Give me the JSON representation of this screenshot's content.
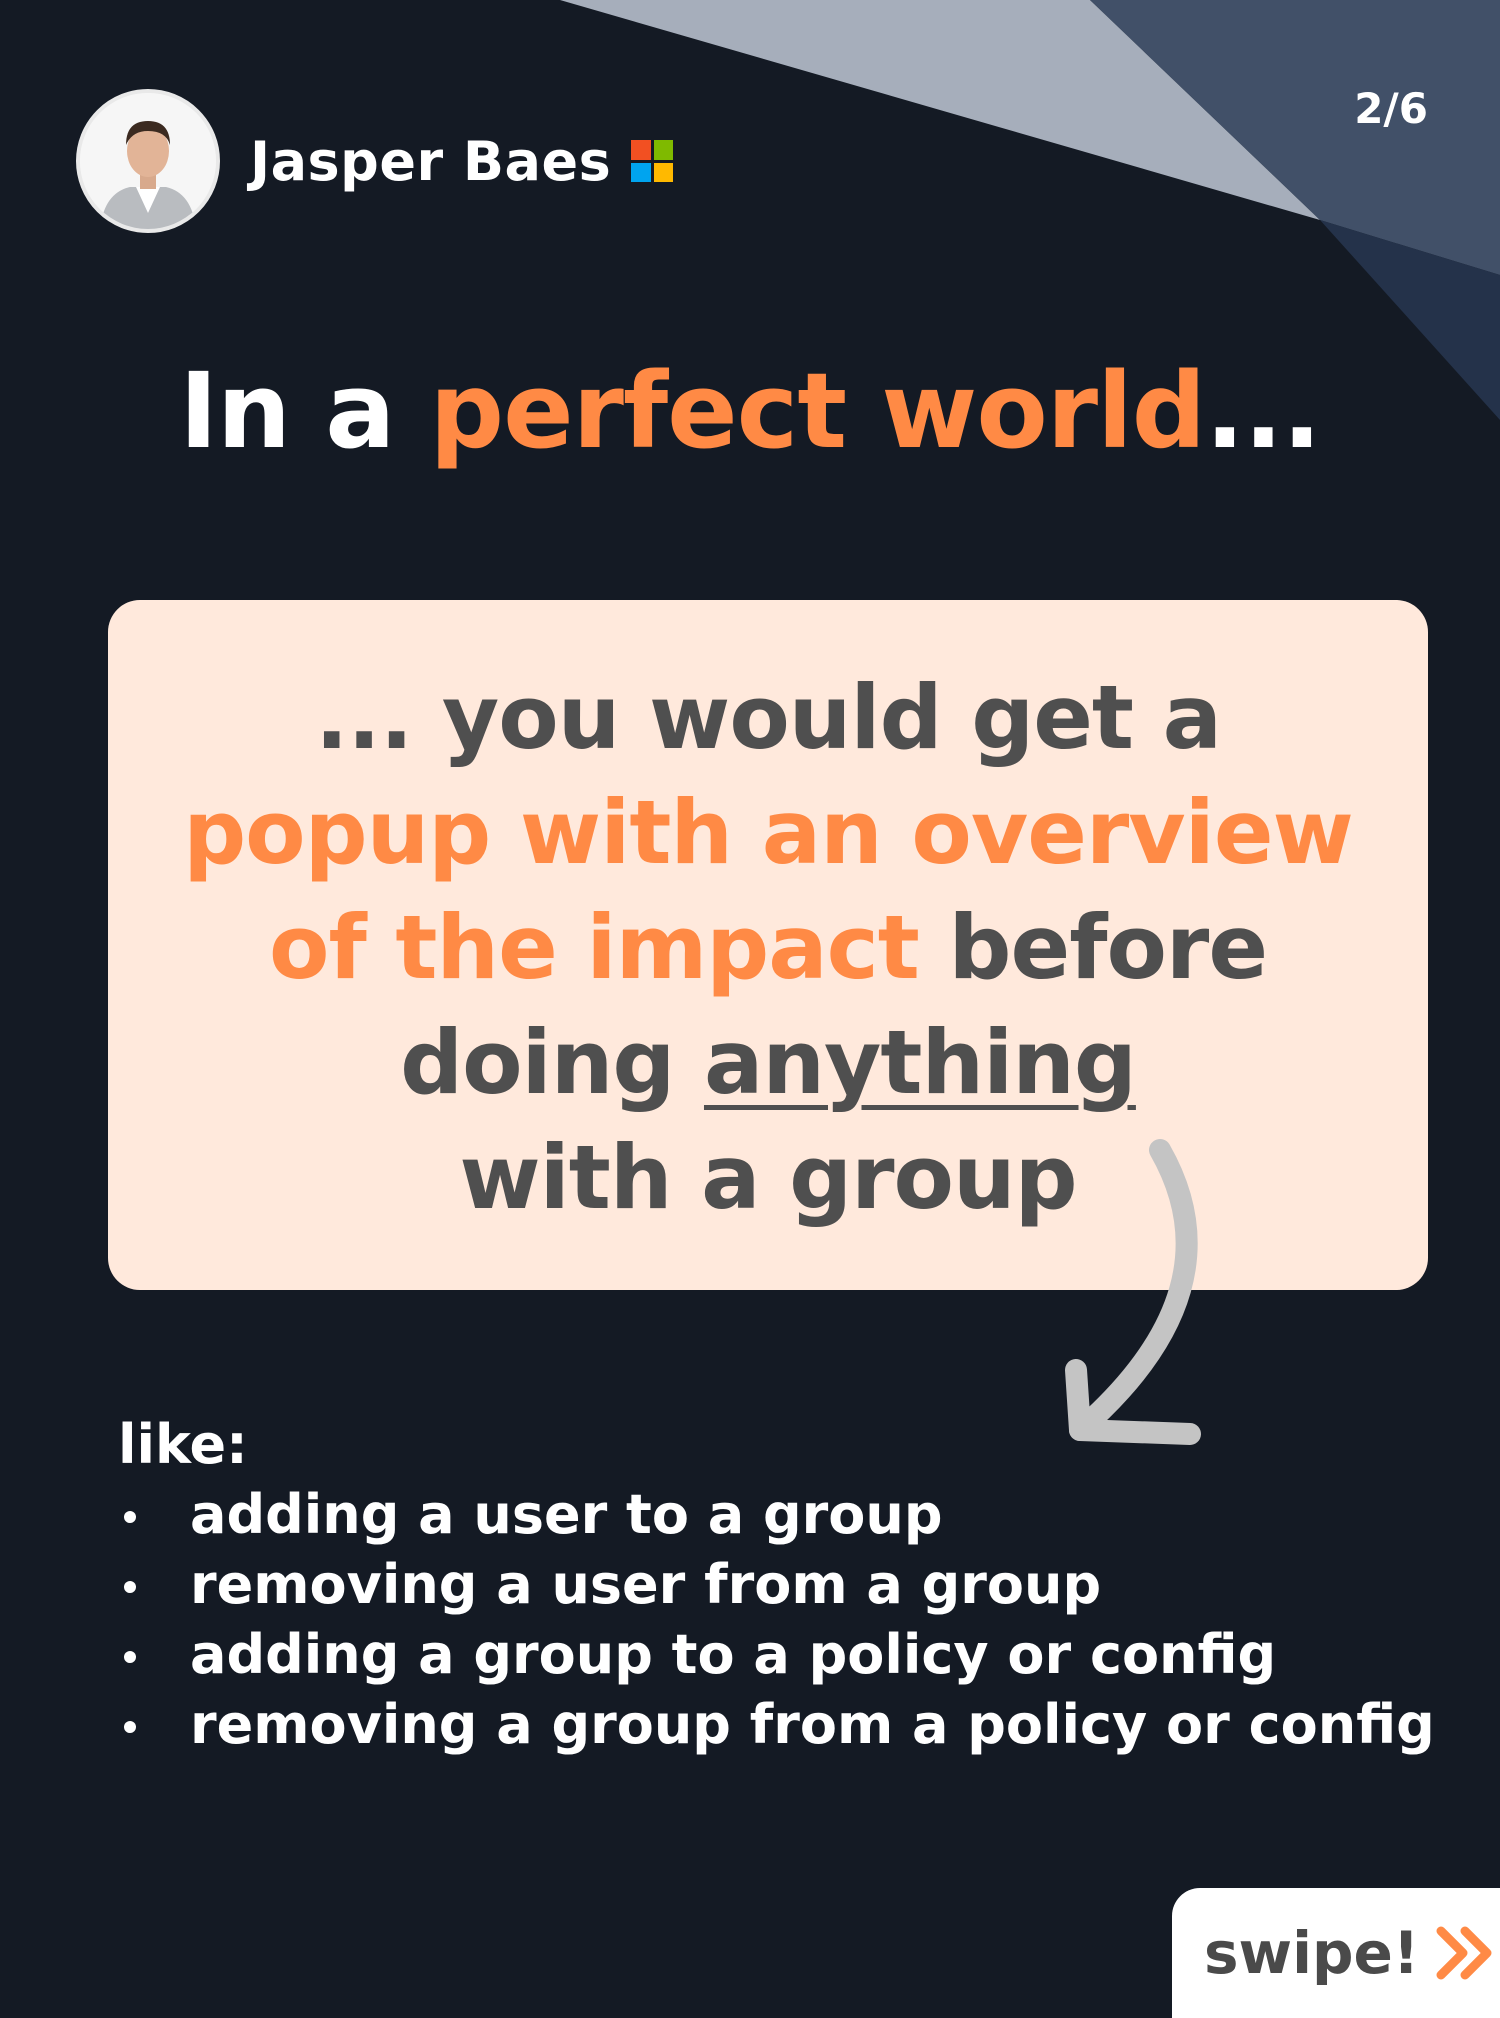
{
  "author": {
    "name": "Jasper Baes",
    "badge_icon": "microsoft-logo-icon",
    "badge_colors": [
      "#f25022",
      "#7fba00",
      "#00a4ef",
      "#ffb900"
    ]
  },
  "page_indicator": "2/6",
  "headline": {
    "prefix": "In a ",
    "highlight": "perfect world",
    "suffix": "..."
  },
  "card": {
    "line1": "... you would get a",
    "line2": "popup with an overview",
    "line3_highlight": "of the impact",
    "line3_rest": " before",
    "line4_prefix": "doing ",
    "line4_underlined": "anything",
    "line5": "with a group"
  },
  "list": {
    "intro": "like:",
    "items": [
      "adding a user to a group",
      "removing a user from a group",
      "adding a group to a policy or config",
      "removing a group from a policy or config"
    ]
  },
  "swipe": {
    "label": "swipe!",
    "icon": "double-chevron-right-icon"
  },
  "colors": {
    "background": "#141a24",
    "accent": "#ff8a45",
    "card_background": "#ffe9dc",
    "card_text": "#4f4f4f"
  }
}
